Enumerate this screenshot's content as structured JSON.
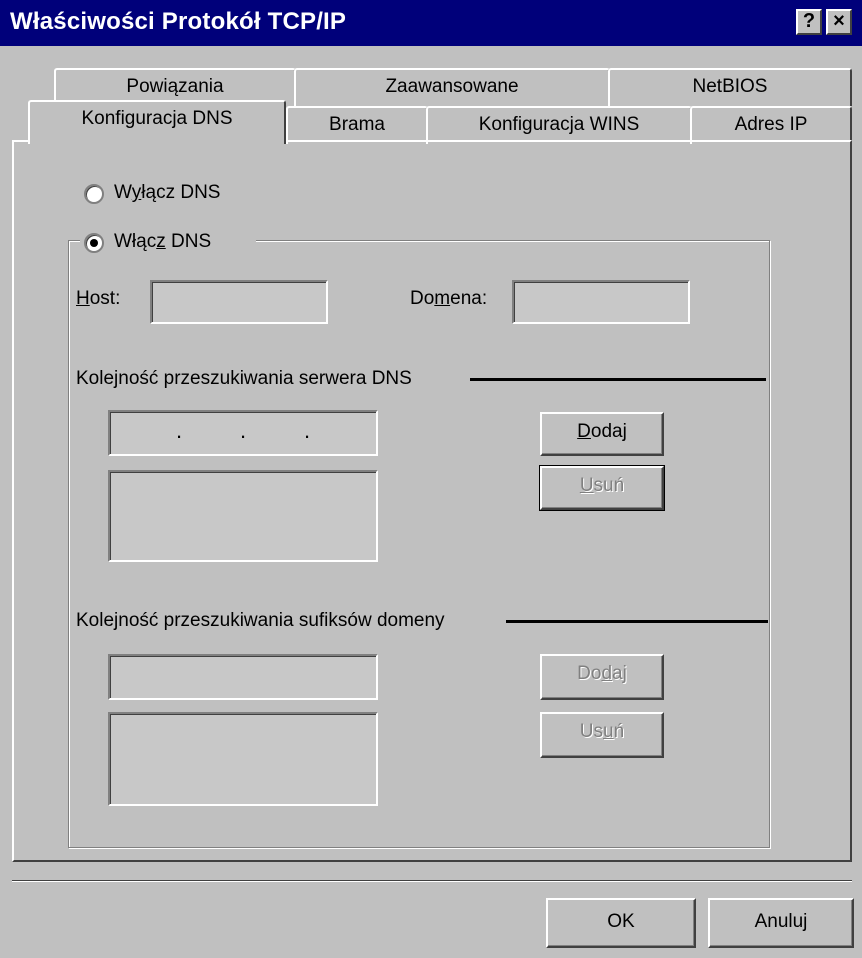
{
  "window": {
    "title": "Właściwości Protokół TCP/IP",
    "help_button": "?",
    "close_button": "×"
  },
  "tabs": {
    "back_row": [
      {
        "label": "Powiązania"
      },
      {
        "label": "Zaawansowane"
      },
      {
        "label": "NetBIOS"
      }
    ],
    "front_row": [
      {
        "label": "Konfiguracja DNS",
        "active": true
      },
      {
        "label": "Brama"
      },
      {
        "label": "Konfiguracja WINS"
      },
      {
        "label": "Adres IP"
      }
    ]
  },
  "dns": {
    "disable": {
      "pre": "W",
      "key": "y",
      "post": "łącz DNS",
      "checked": false
    },
    "enable": {
      "pre": "Włąc",
      "key": "z",
      "post": " DNS",
      "checked": true
    },
    "host_label": {
      "key": "H",
      "post": "ost:"
    },
    "host_value": "",
    "domain_label": {
      "pre": "Do",
      "key": "m",
      "post": "ena:"
    },
    "domain_value": "",
    "server_order": {
      "heading": "Kolejność przeszukiwania serwera DNS",
      "ip_dots": [
        ".",
        ".",
        "."
      ],
      "add": {
        "key": "D",
        "post": "odaj",
        "enabled": true
      },
      "remove": {
        "key": "U",
        "post": "suń",
        "enabled": false
      }
    },
    "suffix_order": {
      "heading": "Kolejność przeszukiwania sufiksów domeny",
      "add": {
        "pre": "Do",
        "key": "d",
        "post": "aj",
        "enabled": false
      },
      "remove": {
        "pre": "Us",
        "key": "u",
        "post": "ń",
        "enabled": false
      }
    }
  },
  "footer": {
    "ok": "OK",
    "cancel": "Anuluj"
  }
}
